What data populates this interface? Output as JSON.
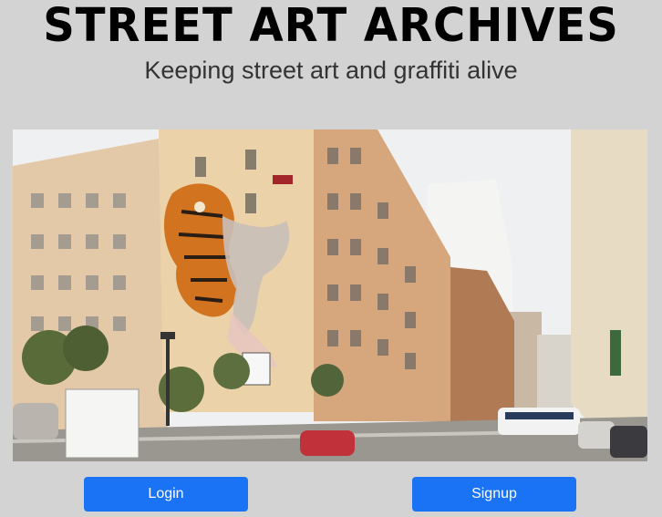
{
  "header": {
    "title": "STREET ART ARCHIVES",
    "subtitle": "Keeping street art and graffiti alive"
  },
  "hero": {
    "description": "Photograph of a large mural of a tiger and a skeletal creature painted on the side of an apartment building on a city street",
    "icon": "street-mural-photo"
  },
  "actions": {
    "login_label": "Login",
    "signup_label": "Signup"
  },
  "colors": {
    "background": "#d3d3d3",
    "button": "#1a73f5",
    "button_text": "#ffffff"
  }
}
